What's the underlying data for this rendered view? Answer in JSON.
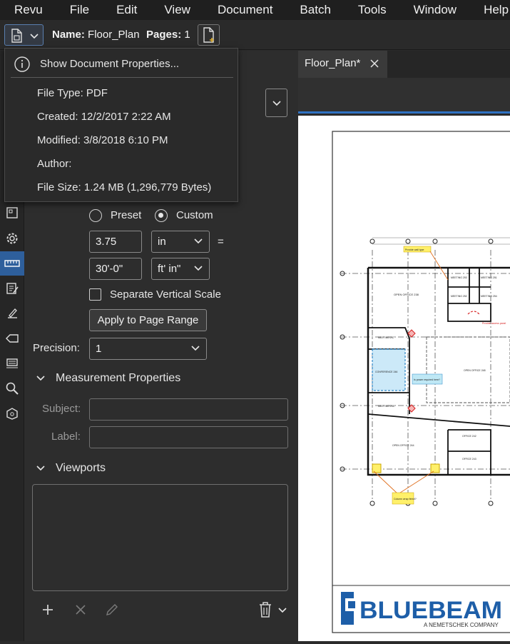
{
  "menubar": [
    "Revu",
    "File",
    "Edit",
    "View",
    "Document",
    "Batch",
    "Tools",
    "Window",
    "Help"
  ],
  "toolbar": {
    "name_label": "Name:",
    "name_value": "Floor_Plan",
    "pages_label": "Pages:",
    "pages_value": "1"
  },
  "doc_menu": {
    "show_properties": "Show Document Properties...",
    "file_type": "File Type: PDF",
    "created": "Created: 12/2/2017 2:22 AM",
    "modified": "Modified: 3/8/2018 6:10 PM",
    "author": "Author:",
    "file_size": "File Size: 1.24 MB (1,296,779 Bytes)"
  },
  "scale": {
    "preset_label": "Preset",
    "custom_label": "Custom",
    "selected": "Custom",
    "doc_value": "3.75",
    "doc_unit": "in",
    "equals": "=",
    "real_value": "30'-0\"",
    "real_unit": "ft' in\"",
    "separate_vertical": "Separate Vertical Scale",
    "separate_vertical_checked": false,
    "apply_button": "Apply to Page Range",
    "precision_label": "Precision:",
    "precision_value": "1"
  },
  "measurement_properties": {
    "title": "Measurement Properties",
    "subject_label": "Subject:",
    "label_label": "Label:"
  },
  "viewports": {
    "title": "Viewports"
  },
  "tab": {
    "label": "Floor_Plan*"
  },
  "drawing": {
    "rooms": [
      "OPEN OFFICE 238",
      "MEETING 253",
      "MEETING 251",
      "MEETING 252",
      "MEETING 254",
      "MEETING 247",
      "CONFERENCE 246",
      "MEETING 245",
      "OPEN OFFICE 248",
      "OPEN OFFICE 244",
      "OFFICE 242",
      "OFFICE 243"
    ],
    "callouts": [
      "Provide wall type",
      "Provide access panel",
      "Is power required here?",
      "Column wrap finish?"
    ],
    "logo": "BLUEBEAM",
    "logo_sub": "A NEMETSCHEK COMPANY"
  },
  "colors": {
    "accent": "#2f72c3",
    "active_tool": "#2e5f9c",
    "logo_blue": "#1d5ea8",
    "callout": "#fff06a",
    "markup_red": "#d62020"
  }
}
